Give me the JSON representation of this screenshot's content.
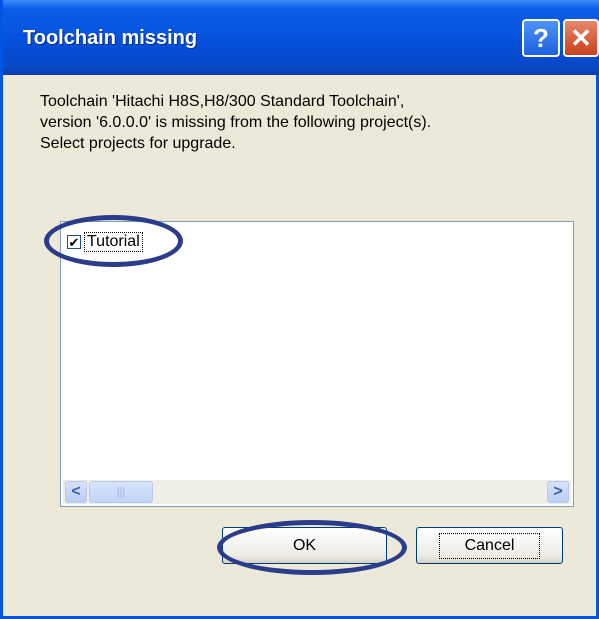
{
  "dialog": {
    "title": "Toolchain missing",
    "help_glyph": "?",
    "close_glyph": "✕",
    "message_lines": [
      "Toolchain 'Hitachi H8S,H8/300 Standard Toolchain',",
      "version '6.0.0.0' is missing from the following project(s).",
      "Select projects for upgrade."
    ]
  },
  "project_list": {
    "items": [
      {
        "label": "Tutorial",
        "checked": true,
        "check_glyph": "✔"
      }
    ],
    "scroll_left_glyph": "<",
    "scroll_right_glyph": ">",
    "thumb_grip": "|||"
  },
  "buttons": {
    "ok_label": "OK",
    "cancel_label": "Cancel"
  },
  "colors": {
    "titlebar": "#0550dc",
    "dialog_bg": "#ece9d8",
    "annotation_ring": "#2b3c8a"
  }
}
